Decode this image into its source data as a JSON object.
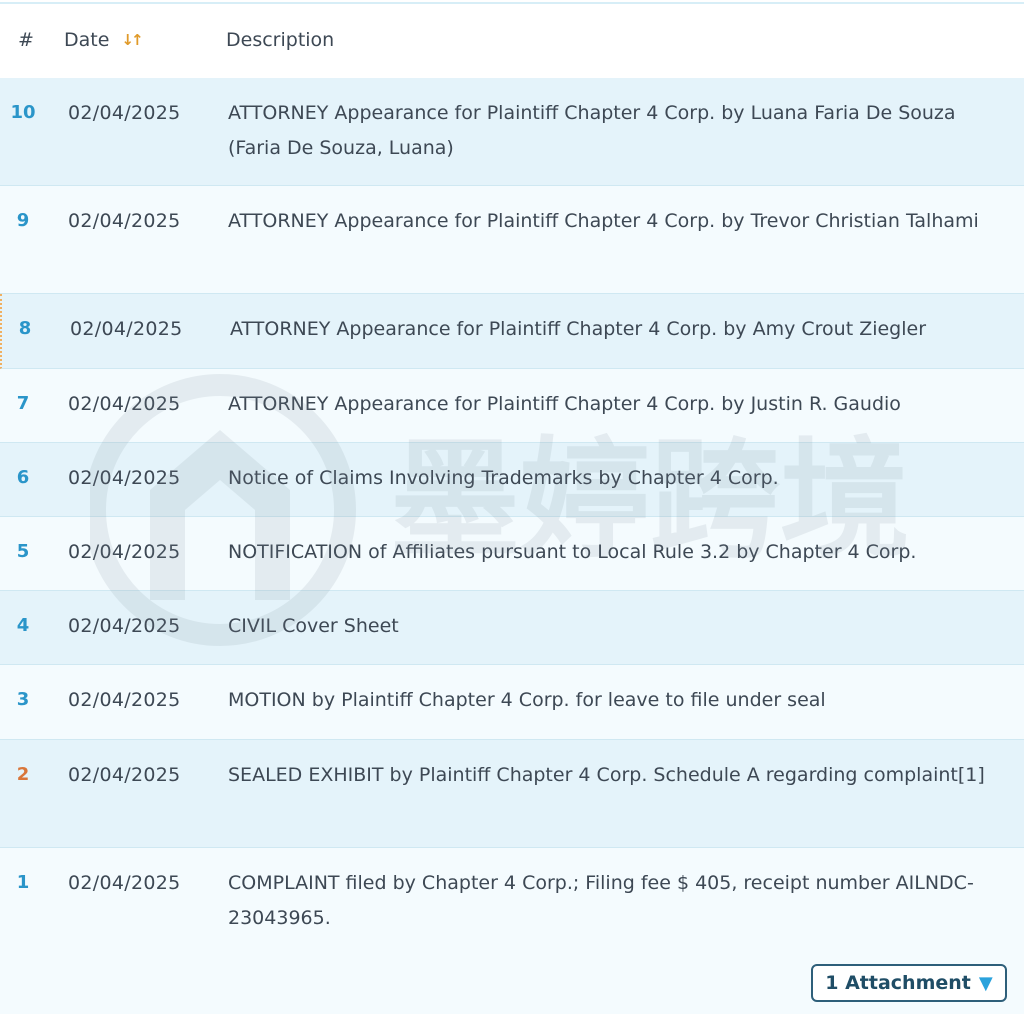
{
  "header": {
    "num_label": "#",
    "date_label": "Date",
    "sort_glyph": "↓↑",
    "description_label": "Description"
  },
  "entries": [
    {
      "num": "10",
      "date": "02/04/2025",
      "description": "ATTORNEY Appearance for Plaintiff Chapter 4 Corp. by Luana Faria De Souza (Faria De Souza, Luana)"
    },
    {
      "num": "9",
      "date": "02/04/2025",
      "description": "ATTORNEY Appearance for Plaintiff Chapter 4 Corp. by Trevor Christian Talhami"
    },
    {
      "num": "8",
      "date": "02/04/2025",
      "description": "ATTORNEY Appearance for Plaintiff Chapter 4 Corp. by Amy Crout Ziegler"
    },
    {
      "num": "7",
      "date": "02/04/2025",
      "description": "ATTORNEY Appearance for Plaintiff Chapter 4 Corp. by Justin R. Gaudio"
    },
    {
      "num": "6",
      "date": "02/04/2025",
      "description": "Notice of Claims Involving Trademarks by Chapter 4 Corp."
    },
    {
      "num": "5",
      "date": "02/04/2025",
      "description": "NOTIFICATION of Affiliates pursuant to Local Rule 3.2 by Chapter 4 Corp."
    },
    {
      "num": "4",
      "date": "02/04/2025",
      "description": "CIVIL Cover Sheet"
    },
    {
      "num": "3",
      "date": "02/04/2025",
      "description": "MOTION by Plaintiff Chapter 4 Corp. for leave to file under seal"
    },
    {
      "num": "2",
      "date": "02/04/2025",
      "description": "SEALED EXHIBIT by Plaintiff Chapter 4 Corp. Schedule A regarding complaint[1]"
    },
    {
      "num": "1",
      "date": "02/04/2025",
      "description": "COMPLAINT filed by Chapter 4 Corp.; Filing fee $ 405, receipt number AILNDC-23043965."
    }
  ],
  "attachment_button": {
    "label": "1 Attachment",
    "caret": "▼"
  },
  "watermark_text": "墨婷跨境",
  "colors": {
    "entry_number": "#2a95c9",
    "sealed_entry_number": "#d9763a",
    "row_shaded": "#e4f3fa",
    "row_light": "#f4fbfe",
    "sort_icon": "#e09a2a"
  }
}
